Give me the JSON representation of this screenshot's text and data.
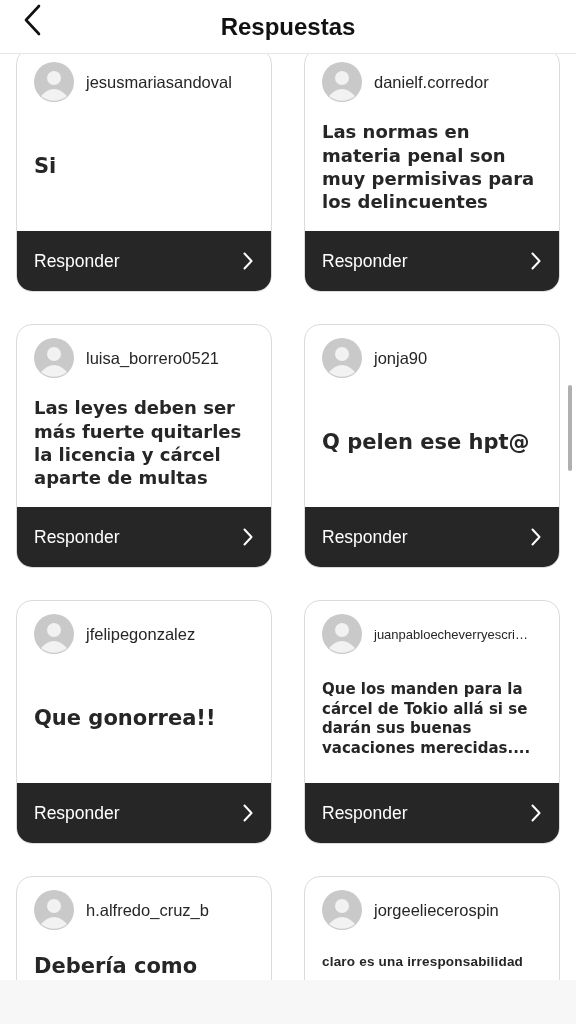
{
  "header": {
    "title": "Respuestas"
  },
  "replies": [
    {
      "user": "jesusmariasandoval",
      "text": "Si",
      "action": "Responder"
    },
    {
      "user": "danielf.corredor",
      "text": "Las normas en materia penal son muy permisivas para los delincuentes",
      "action": "Responder"
    },
    {
      "user": "luisa_borrero0521",
      "text": "Las leyes deben ser más fuerte quitarles la licencia y cárcel aparte de multas",
      "action": "Responder"
    },
    {
      "user": "jonja90",
      "text": "Q pelen ese hpt@",
      "action": "Responder"
    },
    {
      "user": "jfelipegonzalez",
      "text": "Que gonorrea!!",
      "action": "Responder"
    },
    {
      "user": "juanpabloecheverryescri…",
      "text": "Que los manden para la cárcel de Tokio allá si se darán sus buenas vacaciones merecidas....",
      "action": "Responder"
    },
    {
      "user": "h.alfredo_cruz_b",
      "text": "Debería como"
    },
    {
      "user": "jorgeeliecerospin",
      "text": "claro es una irresponsabilidad"
    }
  ]
}
